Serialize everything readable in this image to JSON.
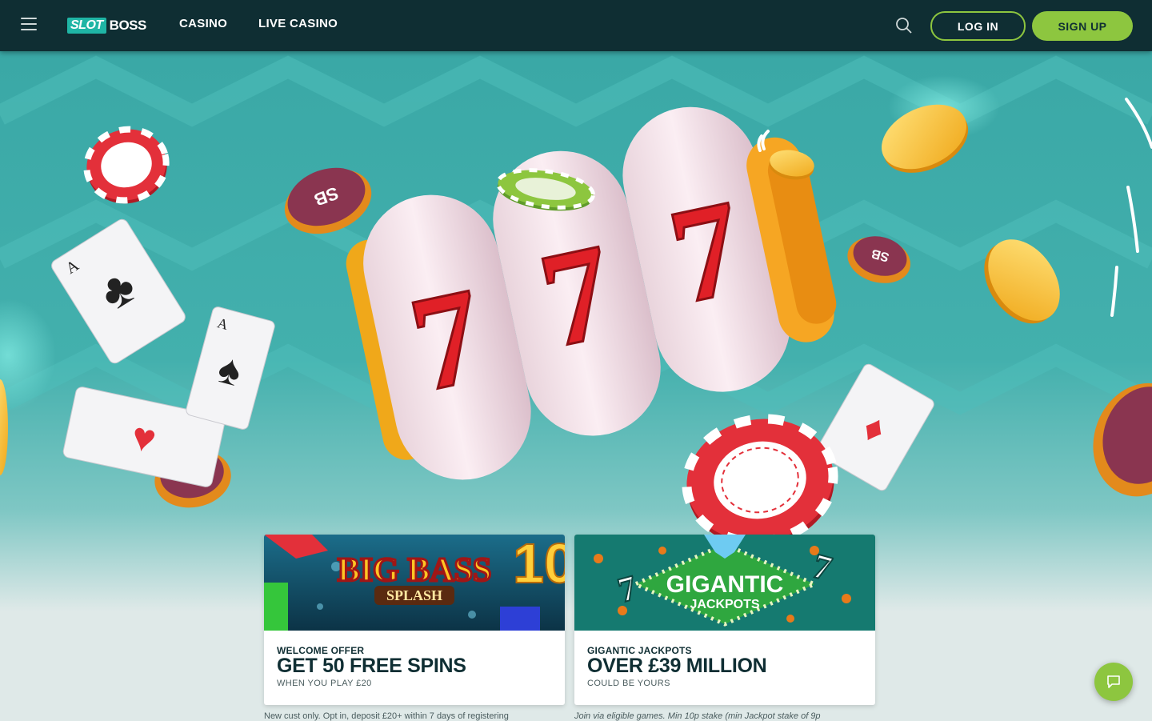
{
  "brand": {
    "logo_part1": "SLOT",
    "logo_part2": "BOSS"
  },
  "nav": {
    "links": [
      "CASINO",
      "LIVE CASINO"
    ],
    "login_label": "LOG IN",
    "signup_label": "SIGN UP",
    "menu_icon": "hamburger-icon",
    "search_icon": "search-icon"
  },
  "hero": {
    "reel_symbol": "7",
    "chip_text": "SB"
  },
  "promos": [
    {
      "image_title": "BIG BASS",
      "image_subtitle": "SPLASH",
      "image_badge": "10",
      "kicker": "WELCOME OFFER",
      "headline": "GET 50 FREE SPINS",
      "sub": "WHEN YOU PLAY £20",
      "terms": "New cust only. Opt in, deposit £20+ within 7 days of registering"
    },
    {
      "image_title": "GIGANTIC",
      "image_subtitle": "JACKPOTS",
      "kicker": "GIGANTIC JACKPOTS",
      "headline": "OVER £39 MILLION",
      "sub": "COULD BE YOURS",
      "terms": "Join via eligible games. Min 10p stake (min Jackpot stake of 9p"
    }
  ],
  "chat": {
    "icon": "chat-icon"
  },
  "colors": {
    "nav_bg": "#0f2e33",
    "accent_green": "#8dc63f",
    "logo_teal": "#1fb5a5",
    "hero_teal": "#3aa8a6"
  }
}
